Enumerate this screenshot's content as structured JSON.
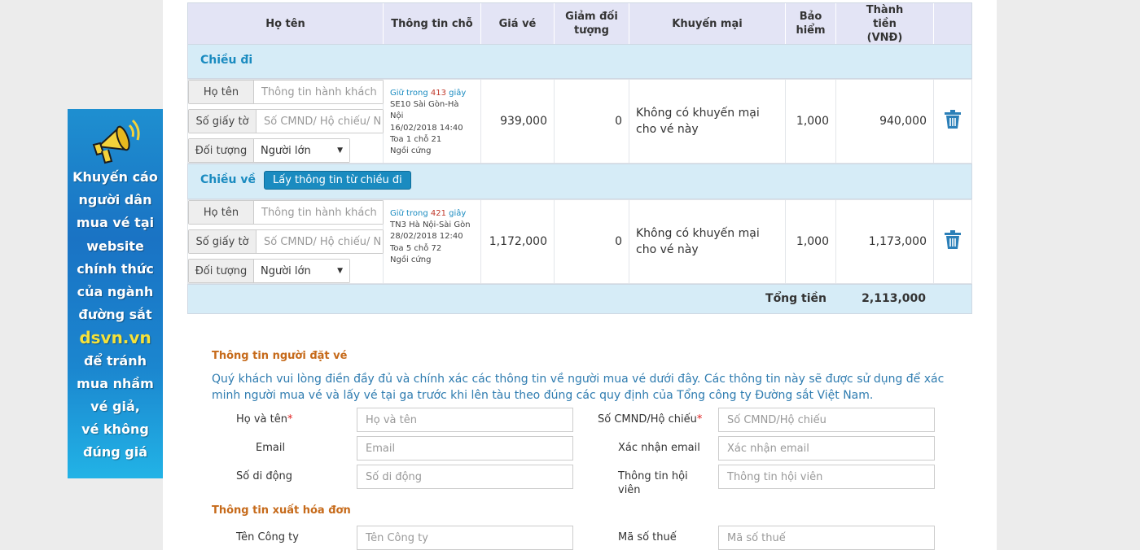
{
  "promo": {
    "lines": [
      "Khuyến cáo",
      "người dân",
      "mua vé tại",
      "website",
      "chính thức",
      "của ngành",
      "đường sắt"
    ],
    "highlight": "dsvn.vn",
    "lines2": [
      "để tránh",
      "mua nhầm",
      "vé giả,",
      "vé không",
      "đúng giá"
    ],
    "icon": "megaphone-icon"
  },
  "table": {
    "headers": {
      "name": "Họ tên",
      "seat": "Thông tin chỗ",
      "price": "Giá vé",
      "discount": "Giảm đối tượng",
      "promotion": "Khuyến mại",
      "insurance": "Bảo hiểm",
      "total": "Thành tiền (VNĐ)"
    },
    "outbound_label": "Chiều đi",
    "return_label": "Chiều về",
    "copy_button": "Lấy thông tin từ chiều đi",
    "field_labels": {
      "name": "Họ tên",
      "id": "Số giấy tờ",
      "type": "Đối tượng"
    },
    "placeholders": {
      "name": "Thông tin hành khách",
      "id": "Số CMND/ Hộ chiếu/ N"
    },
    "passenger_type": "Người lớn",
    "rows": [
      {
        "hold_prefix": "Giữ trong",
        "hold_seconds": "413",
        "hold_suffix": "giây",
        "train": "SE10 Sài Gòn-Hà",
        "train2": "Nội",
        "datetime": "16/02/2018 14:40",
        "car": "Toa 1 chỗ 21",
        "seat_type": "Ngồi cứng",
        "price": "939,000",
        "discount": "0",
        "promotion_line1": "Không có khuyến mại",
        "promotion_line2": "cho vé này",
        "insurance": "1,000",
        "total": "940,000"
      },
      {
        "hold_prefix": "Giữ trong",
        "hold_seconds": "421",
        "hold_suffix": "giây",
        "train": "TN3 Hà Nội-Sài Gòn",
        "train2": "",
        "datetime": "28/02/2018 12:40",
        "car": "Toa 5 chỗ 72",
        "seat_type": "Ngồi cứng",
        "price": "1,172,000",
        "discount": "0",
        "promotion_line1": "Không có khuyến mại",
        "promotion_line2": "cho vé này",
        "insurance": "1,000",
        "total": "1,173,000"
      }
    ],
    "total_label": "Tổng tiền",
    "total_value": "2,113,000"
  },
  "buyer": {
    "heading": "Thông tin người đặt vé",
    "note": "Quý khách vui lòng điền đầy đủ và chính xác các thông tin về người mua vé dưới đây. Các thông tin này sẽ được sử dụng để xác minh người mua vé và lấy vé tại ga trước khi lên tàu theo đúng các quy định của Tổng công ty Đường sắt Việt Nam.",
    "name_label": "Họ và tên",
    "name_ph": "Họ và tên",
    "id_label": "Số CMND/Hộ chiếu",
    "id_ph": "Số CMND/Hộ chiếu",
    "email_label": "Email",
    "email_ph": "Email",
    "email_confirm_label": "Xác nhận email",
    "email_confirm_ph": "Xác nhận email",
    "phone_label": "Số di động",
    "phone_ph": "Số di động",
    "member_label1": "Thông tin hội",
    "member_label2": "viên",
    "member_ph": "Thông tin hội viên",
    "required_mark": "*"
  },
  "invoice": {
    "heading": "Thông tin xuất hóa đơn",
    "company_label": "Tên Công ty",
    "company_ph": "Tên Công ty",
    "tax_label": "Mã số thuế",
    "tax_ph": "Mã số thuế"
  }
}
